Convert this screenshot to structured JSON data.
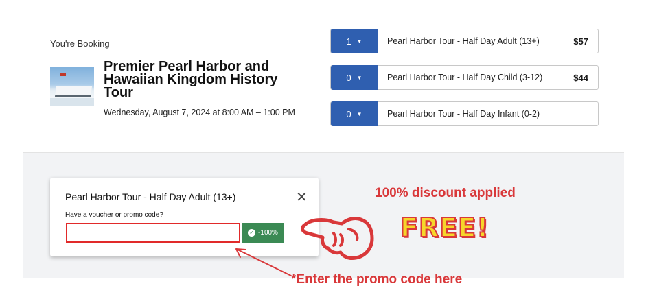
{
  "booking": {
    "label": "You're Booking",
    "tour_title": "Premier Pearl Harbor and Hawaiian Kingdom History Tour",
    "date": "Wednesday, August 7, 2024 at 8:00 AM – 1:00 PM"
  },
  "tickets": [
    {
      "qty": "1",
      "name": "Pearl Harbor Tour - Half Day Adult (13+)",
      "price": "$57"
    },
    {
      "qty": "0",
      "name": "Pearl Harbor Tour - Half Day Child (3-12)",
      "price": "$44"
    },
    {
      "qty": "0",
      "name": "Pearl Harbor Tour - Half Day Infant (0-2)",
      "price": ""
    }
  ],
  "promo": {
    "title": "Pearl Harbor Tour - Half Day Adult (13+)",
    "question": "Have a voucher or promo code?",
    "input_value": "",
    "badge": "-100%"
  },
  "annotations": {
    "discount": "100% discount applied",
    "free": "FREE!",
    "enter_note": "*Enter the promo code here"
  },
  "colors": {
    "accent_blue": "#2f5fb0",
    "annotation_red": "#d9383a",
    "badge_green": "#3b8a54",
    "free_yellow": "#f6d62a"
  },
  "icons": {
    "close": "close-icon",
    "check": "check-circle-icon",
    "caret": "chevron-down-icon"
  }
}
